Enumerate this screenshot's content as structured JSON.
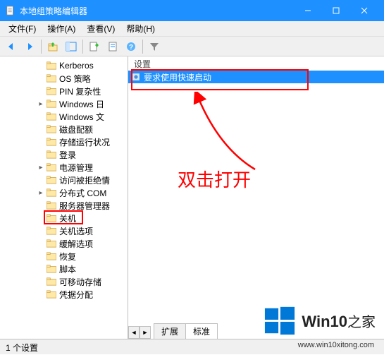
{
  "window": {
    "title": "本地组策略编辑器"
  },
  "menu": {
    "file": "文件(F)",
    "action": "操作(A)",
    "view": "查看(V)",
    "help": "帮助(H)"
  },
  "tree": {
    "items": [
      {
        "label": "Kerberos",
        "expand": ""
      },
      {
        "label": "OS 策略",
        "expand": ""
      },
      {
        "label": "PIN 复杂性",
        "expand": ""
      },
      {
        "label": "Windows 日",
        "expand": ">"
      },
      {
        "label": "Windows 文",
        "expand": ""
      },
      {
        "label": "磁盘配额",
        "expand": ""
      },
      {
        "label": "存储运行状况",
        "expand": ""
      },
      {
        "label": "登录",
        "expand": ""
      },
      {
        "label": "电源管理",
        "expand": ">"
      },
      {
        "label": "访问被拒绝情",
        "expand": ""
      },
      {
        "label": "分布式 COM",
        "expand": ">"
      },
      {
        "label": "服务器管理器",
        "expand": ""
      },
      {
        "label": "关机",
        "expand": ""
      },
      {
        "label": "关机选项",
        "expand": ""
      },
      {
        "label": "缓解选项",
        "expand": ""
      },
      {
        "label": "恢复",
        "expand": ""
      },
      {
        "label": "脚本",
        "expand": ""
      },
      {
        "label": "可移动存储",
        "expand": ""
      },
      {
        "label": "凭据分配",
        "expand": ""
      }
    ]
  },
  "detail": {
    "header": "设置",
    "selected": "要求使用快速启动",
    "tabs": {
      "extended": "扩展",
      "standard": "标准"
    }
  },
  "annotation": {
    "text": "双击打开"
  },
  "status": {
    "text": "1 个设置"
  },
  "watermark": {
    "brand": "Win10",
    "suffix": "之家",
    "url": "www.win10xitong.com"
  }
}
